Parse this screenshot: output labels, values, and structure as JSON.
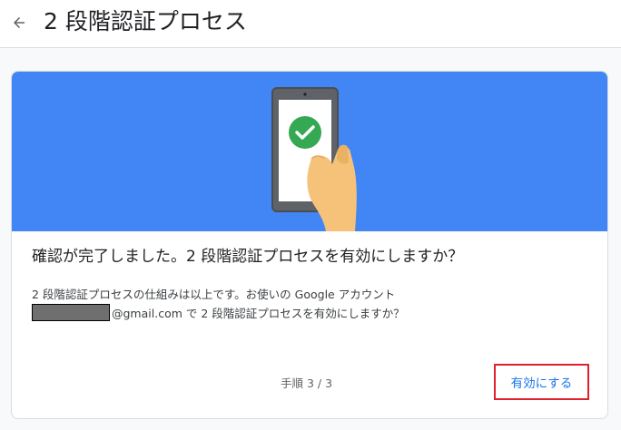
{
  "header": {
    "back_icon": "arrow-left-icon",
    "title": "2 段階認証プロセス"
  },
  "hero": {
    "background_color": "#4285f4",
    "illustration": "phone-checkmark-illustration"
  },
  "card": {
    "question": "確認が完了しました。2 段階認証プロセスを有効にしますか？",
    "description_line1": "2 段階認証プロセスの仕組みは以上です。お使いの Google アカウント",
    "description_line2_suffix": "@gmail.com で 2 段階認証プロセスを有効にしますか？",
    "step_label": "手順 3 / 3",
    "enable_button_label": "有効にする",
    "accent_color": "#1a73e8",
    "highlight_color": "#e0212b"
  }
}
